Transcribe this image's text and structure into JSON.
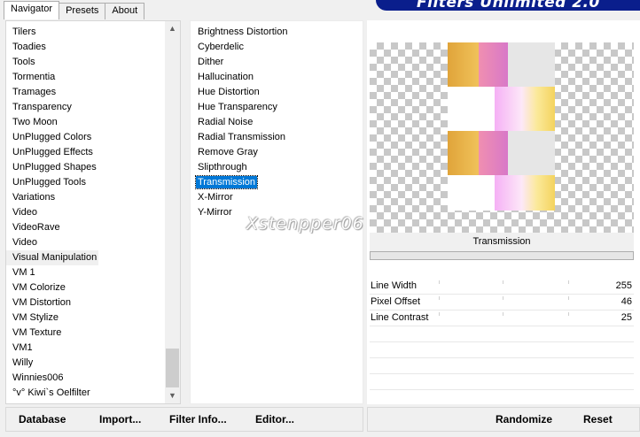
{
  "tabs": [
    {
      "label": "Navigator",
      "active": true
    },
    {
      "label": "Presets",
      "active": false
    },
    {
      "label": "About",
      "active": false
    }
  ],
  "banner_title": "Filters Unlimited 2.0",
  "categories": [
    "Tilers",
    "Toadies",
    "Tools",
    "Tormentia",
    "Tramages",
    "Transparency",
    "Two Moon",
    "UnPlugged Colors",
    "UnPlugged Effects",
    "UnPlugged Shapes",
    "UnPlugged Tools",
    "Variations",
    "Video",
    "VideoRave",
    "Video",
    "Visual Manipulation",
    "VM 1",
    "VM Colorize",
    "VM Distortion",
    "VM Stylize",
    "VM Texture",
    "VM1",
    "Willy",
    "Winnies006",
    "°v° Kiwi`s Oelfilter"
  ],
  "highlighted_category": "Visual Manipulation",
  "filters": [
    "Brightness Distortion",
    "Cyberdelic",
    "Dither",
    "Hallucination",
    "Hue Distortion",
    "Hue Transparency",
    "Radial Noise",
    "Radial Transmission",
    "Remove Gray",
    "Slipthrough",
    "Transmission",
    "X-Mirror",
    "Y-Mirror"
  ],
  "selected_filter": "Transmission",
  "watermark": "Xstenpper06",
  "preview": {
    "filter_name": "Transmission"
  },
  "parameters": [
    {
      "label": "Line Width",
      "value": "255"
    },
    {
      "label": "Pixel Offset",
      "value": "46"
    },
    {
      "label": "Line Contrast",
      "value": "25"
    }
  ],
  "buttons": {
    "database": "Database",
    "import": "Import...",
    "filter_info": "Filter Info...",
    "editor": "Editor...",
    "randomize": "Randomize",
    "reset": "Reset"
  },
  "colors": {
    "selection": "#0078d7",
    "banner": "#0a1e8c"
  }
}
